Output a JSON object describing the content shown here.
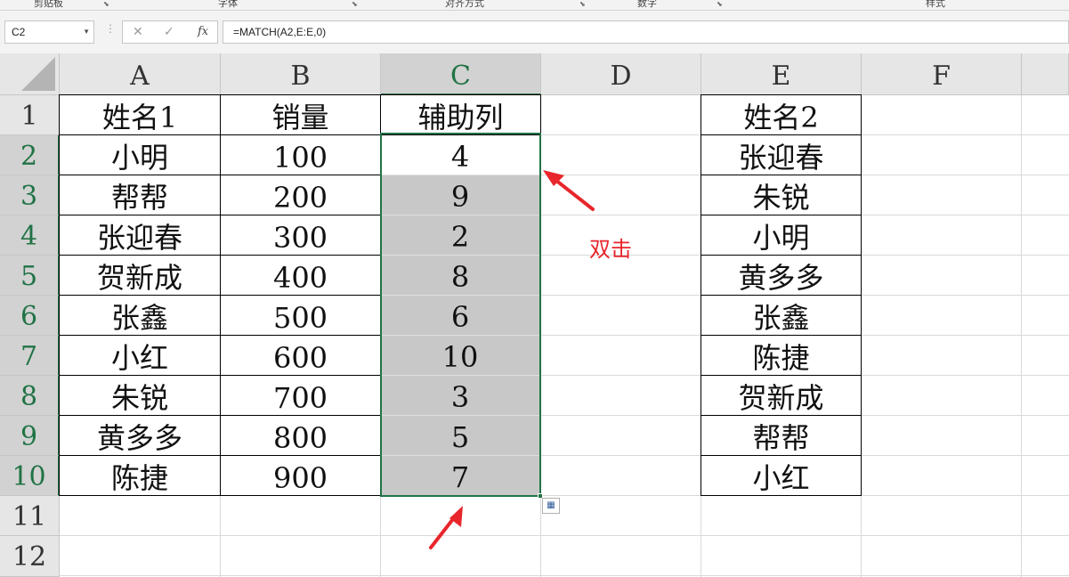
{
  "ribbon": {
    "groups": [
      "剪贴板",
      "字体",
      "对齐方式",
      "数字",
      "样式"
    ]
  },
  "formula_bar": {
    "name_box": "C2",
    "cancel_icon": "✕",
    "enter_icon": "✓",
    "fx_label": "fx",
    "formula": "=MATCH(A2,E:E,0)"
  },
  "columns": [
    "A",
    "B",
    "C",
    "D",
    "E",
    "F"
  ],
  "rows": [
    "1",
    "2",
    "3",
    "4",
    "5",
    "6",
    "7",
    "8",
    "9",
    "10",
    "11",
    "12"
  ],
  "active_cell": "C2",
  "table_left": {
    "headers": [
      "姓名1",
      "销量",
      "辅助列"
    ],
    "rows": [
      [
        "小明",
        "100",
        "4"
      ],
      [
        "帮帮",
        "200",
        "9"
      ],
      [
        "张迎春",
        "300",
        "2"
      ],
      [
        "贺新成",
        "400",
        "8"
      ],
      [
        "张鑫",
        "500",
        "6"
      ],
      [
        "小红",
        "600",
        "10"
      ],
      [
        "朱锐",
        "700",
        "3"
      ],
      [
        "黄多多",
        "800",
        "5"
      ],
      [
        "陈捷",
        "900",
        "7"
      ]
    ]
  },
  "table_right": {
    "header": "姓名2",
    "rows": [
      "张迎春",
      "朱锐",
      "小明",
      "黄多多",
      "张鑫",
      "陈捷",
      "贺新成",
      "帮帮",
      "小红"
    ]
  },
  "annotation": {
    "text": "双击",
    "color": "#e8262c"
  },
  "colors": {
    "selection_green": "#217346",
    "selected_fill": "#c8c8c8",
    "annotation_red": "#e8262c"
  }
}
